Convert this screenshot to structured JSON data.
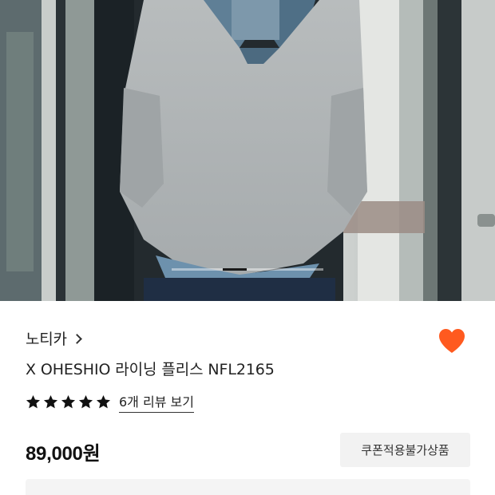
{
  "brand": {
    "name": "노티카"
  },
  "product": {
    "name": "X OHESHIO 라이닝 플리스 NFL2165"
  },
  "rating": {
    "stars": 5,
    "review_link_label": "6개 리뷰 보기"
  },
  "price": {
    "label": "89,000원"
  },
  "badge": {
    "label": "쿠폰적용불가상품"
  },
  "wishlist": {
    "active": true,
    "color": "#ff5a1f"
  },
  "gallery": {
    "alt": "fleece pullover product photo"
  },
  "colors": {
    "accent": "#ff5a1f",
    "star": "#111111",
    "badge_bg": "#f2f2f2"
  }
}
